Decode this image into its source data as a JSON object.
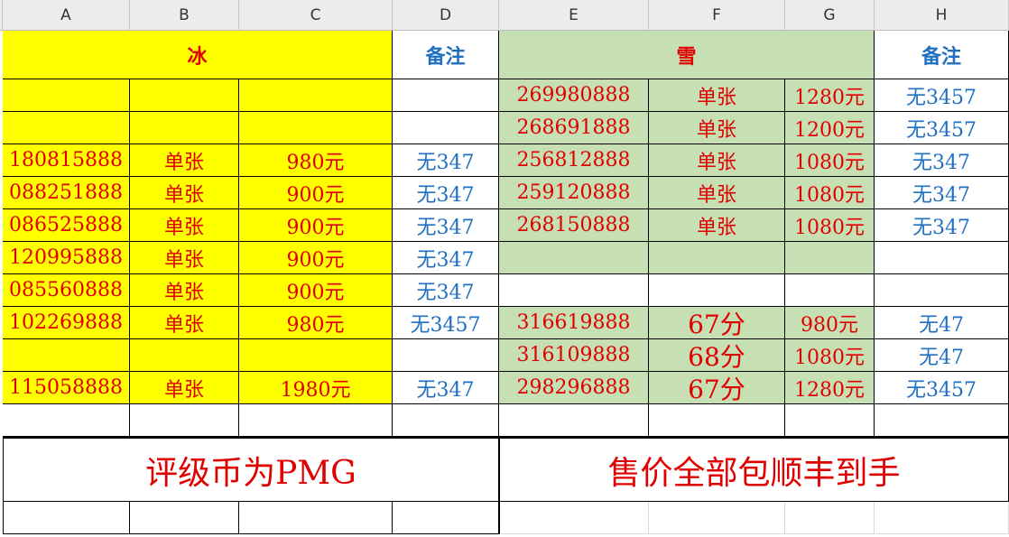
{
  "columns": [
    "A",
    "B",
    "C",
    "D",
    "E",
    "F",
    "G",
    "H"
  ],
  "left": {
    "title": "冰",
    "note_header": "备注",
    "rows": [
      {
        "num": "",
        "type": "",
        "price": "",
        "note": ""
      },
      {
        "num": "",
        "type": "",
        "price": "",
        "note": ""
      },
      {
        "num": "180815888",
        "type": "单张",
        "price": "980元",
        "note": "无347"
      },
      {
        "num": "088251888",
        "type": "单张",
        "price": "900元",
        "note": "无347"
      },
      {
        "num": "086525888",
        "type": "单张",
        "price": "900元",
        "note": "无347"
      },
      {
        "num": "120995888",
        "type": "单张",
        "price": "900元",
        "note": "无347"
      },
      {
        "num": "085560888",
        "type": "单张",
        "price": "900元",
        "note": "无347"
      },
      {
        "num": "102269888",
        "type": "单张",
        "price": "980元",
        "note": "无3457"
      },
      {
        "num": "",
        "type": "",
        "price": "",
        "note": ""
      },
      {
        "num": "115058888",
        "type": "单张",
        "price": "1980元",
        "note": "无347"
      }
    ]
  },
  "right": {
    "title": "雪",
    "note_header": "备注",
    "rows": [
      {
        "num": "269980888",
        "type": "单张",
        "price": "1280元",
        "note": "无3457"
      },
      {
        "num": "268691888",
        "type": "单张",
        "price": "1200元",
        "note": "无3457"
      },
      {
        "num": "256812888",
        "type": "单张",
        "price": "1080元",
        "note": "无347"
      },
      {
        "num": "259120888",
        "type": "单张",
        "price": "1080元",
        "note": "无347"
      },
      {
        "num": "268150888",
        "type": "单张",
        "price": "1080元",
        "note": "无347"
      },
      {
        "num": "",
        "type": "",
        "price": "",
        "note": ""
      },
      {
        "num": "",
        "type": "",
        "price": "",
        "note": ""
      },
      {
        "num": "316619888",
        "type": "67分",
        "price": "980元",
        "note": "无47"
      },
      {
        "num": "316109888",
        "type": "68分",
        "price": "1080元",
        "note": "无47"
      },
      {
        "num": "298296888",
        "type": "67分",
        "price": "1280元",
        "note": "无3457"
      }
    ]
  },
  "footer": {
    "left": "评级币为PMG",
    "right": "售价全部包顺丰到手"
  },
  "colors": {
    "left_fill": "#ffff00",
    "right_fill": "#c6e0b4",
    "value_red": "#e10000",
    "note_blue": "#1f6fc2"
  }
}
